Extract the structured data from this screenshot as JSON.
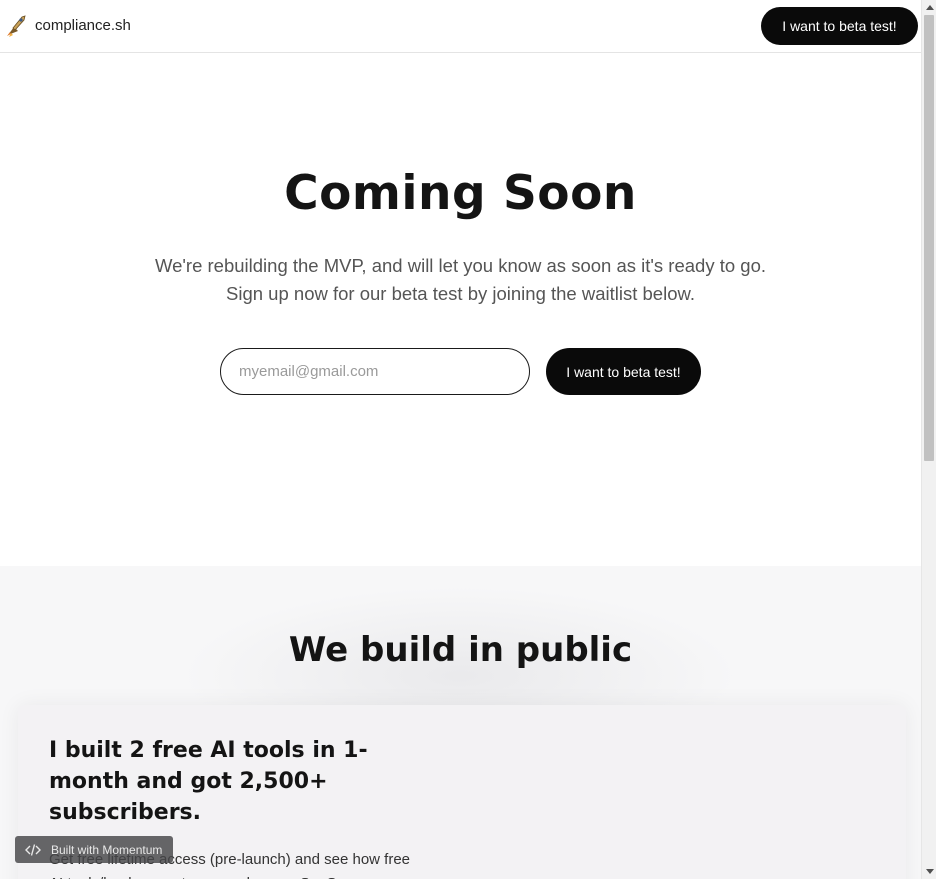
{
  "header": {
    "brand": "compliance.sh",
    "cta_label": "I want to beta test!",
    "logo_icon": "rocket-icon"
  },
  "hero": {
    "title": "Coming Soon",
    "subtitle_line1": "We're rebuilding the MVP, and will let you know as soon as it's ready to go.",
    "subtitle_line2": "Sign up now for our beta test by joining the waitlist below.",
    "email_placeholder": "myemail@gmail.com",
    "email_value": "",
    "cta_label": "I want to beta test!"
  },
  "build_in_public": {
    "title": "We build in public",
    "card": {
      "title": "I built 2 free AI tools in 1-month and got 2,500+ subscribers.",
      "body": "Get free lifetime access (pre-launch) and see how free AI tools/lead magnets can make your SaaS"
    }
  },
  "badge": {
    "label": "Built with Momentum",
    "icon": "code-icon"
  },
  "colors": {
    "button_bg": "#0a0a0a",
    "button_text": "#ffffff",
    "section_bg": "#f7f7f8"
  }
}
